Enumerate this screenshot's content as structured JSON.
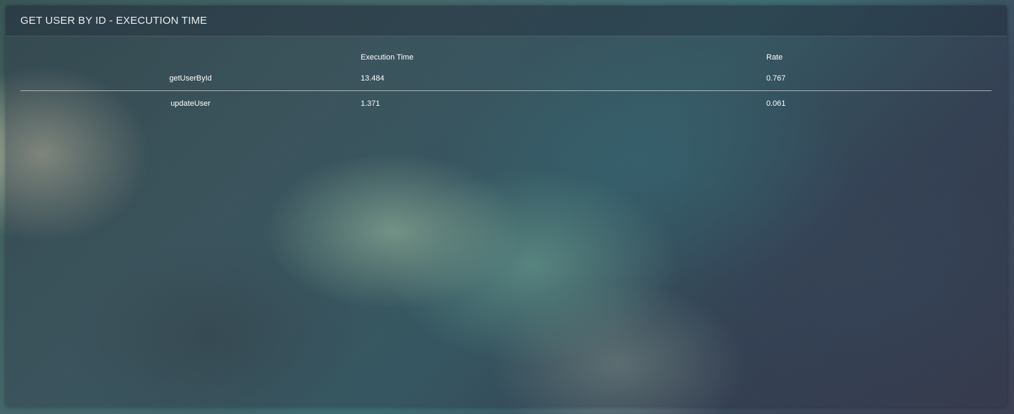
{
  "panel": {
    "title": "GET USER BY ID - EXECUTION TIME"
  },
  "table": {
    "columns": [
      "",
      "Execution Time",
      "Rate"
    ],
    "rows": [
      {
        "name": "getUserById",
        "execution_time": "13.484",
        "rate": "0.767"
      },
      {
        "name": "updateUser",
        "execution_time": "1.371",
        "rate": "0.061"
      }
    ]
  }
}
